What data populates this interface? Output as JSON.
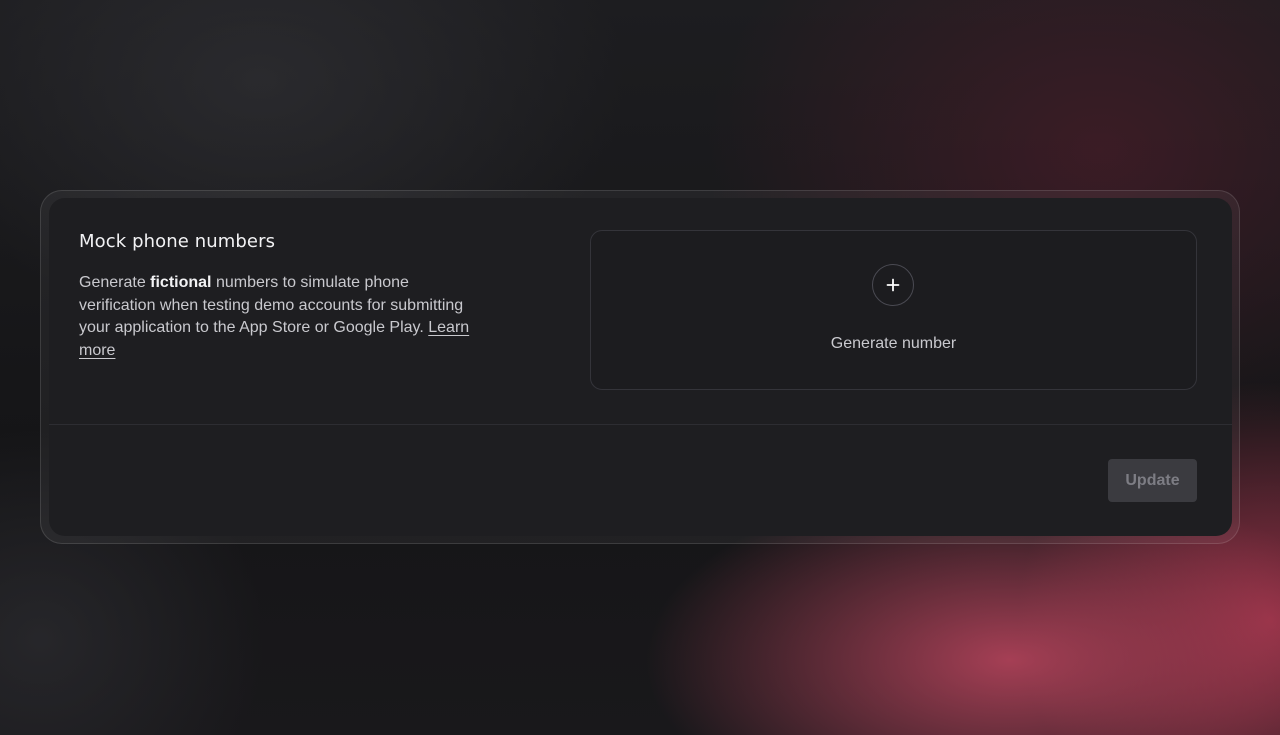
{
  "mock_numbers": {
    "title": "Mock phone numbers",
    "description": {
      "before": "Generate ",
      "emphasis": "fictional",
      "after": " numbers to simulate phone verification when testing demo accounts for submitting your application to the App Store or Google Play. ",
      "link": "Learn more"
    },
    "generate_label": "Generate number",
    "generate_icon": "plus-icon",
    "update_label": "Update",
    "update_disabled": true
  },
  "colors": {
    "background": "#141416",
    "card": "#1e1e21",
    "accent_glow": "#be465f",
    "text_primary": "#f2f2f4",
    "text_secondary": "#c9c9ce",
    "button_disabled_bg": "#3b3b40",
    "button_disabled_text": "#7d7d84"
  }
}
